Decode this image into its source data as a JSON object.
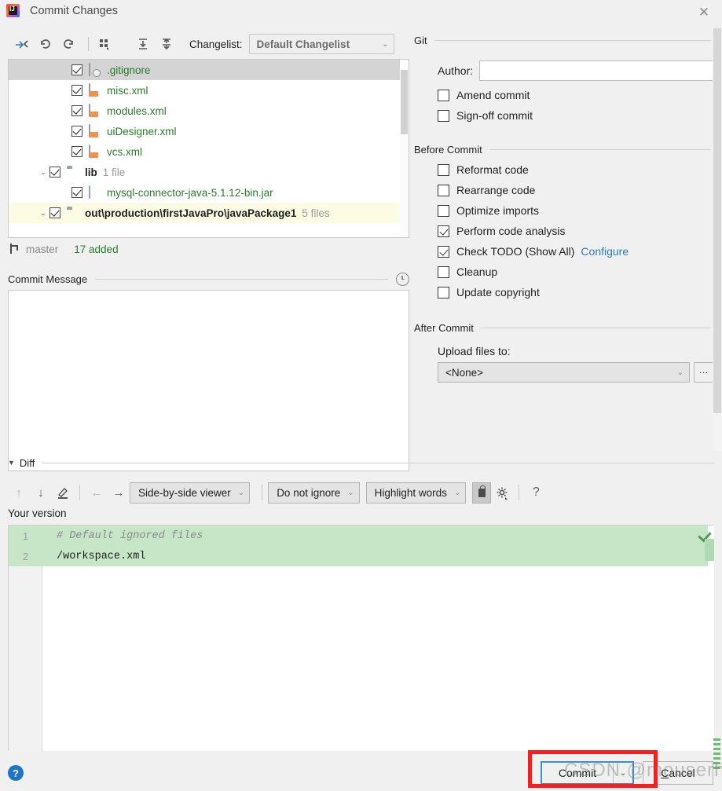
{
  "window": {
    "title": "Commit Changes",
    "app_icon": "intellij-idea-logo",
    "close_label": "✕"
  },
  "changelist_toolbar": {
    "icons": [
      {
        "name": "show-diff-icon",
        "glyph": "→←"
      },
      {
        "name": "rollback-icon",
        "glyph": "↶"
      },
      {
        "name": "refresh-icon",
        "glyph": "↻"
      },
      {
        "name": "group-by-icon",
        "glyph": "▦"
      },
      {
        "name": "expand-all-icon",
        "glyph": "⤓"
      },
      {
        "name": "collapse-all-icon",
        "glyph": "⤒"
      }
    ],
    "changelist_label": "Changelist:",
    "changelist_value": "Default Changelist",
    "chevron": "⌄"
  },
  "file_tree": {
    "rows": [
      {
        "name": ".gitignore",
        "icon": "gitignore-file-icon",
        "checked": true,
        "indent": 1,
        "state": "selected",
        "meta": "",
        "color": "green",
        "expander": ""
      },
      {
        "name": "misc.xml",
        "icon": "xml-file-icon",
        "checked": true,
        "indent": 1,
        "state": "",
        "meta": "",
        "color": "green",
        "expander": ""
      },
      {
        "name": "modules.xml",
        "icon": "xml-file-icon",
        "checked": true,
        "indent": 1,
        "state": "",
        "meta": "",
        "color": "green",
        "expander": ""
      },
      {
        "name": "uiDesigner.xml",
        "icon": "xml-file-icon",
        "checked": true,
        "indent": 1,
        "state": "",
        "meta": "",
        "color": "green",
        "expander": ""
      },
      {
        "name": "vcs.xml",
        "icon": "xml-file-icon",
        "checked": true,
        "indent": 1,
        "state": "",
        "meta": "",
        "color": "green",
        "expander": ""
      },
      {
        "name": "lib",
        "icon": "folder-icon",
        "checked": true,
        "indent": 0,
        "state": "",
        "meta": "1 file",
        "color": "dark",
        "expander": "⌄"
      },
      {
        "name": "mysql-connector-java-5.1.12-bin.jar",
        "icon": "jar-file-icon",
        "checked": true,
        "indent": 1,
        "state": "",
        "meta": "",
        "color": "green",
        "expander": ""
      },
      {
        "name": "out\\production\\firstJavaPro\\javaPackage1",
        "icon": "folder-icon",
        "checked": true,
        "indent": 0,
        "state": "highlighted",
        "meta": "5 files",
        "color": "dark",
        "expander": "⌄"
      }
    ]
  },
  "branch_status": {
    "icon": "git-branch-icon",
    "branch": "master",
    "changes": "17 added"
  },
  "commit_message": {
    "section_label": "Commit Message",
    "history_icon": "clock-icon",
    "value": "",
    "placeholder": ""
  },
  "git_section": {
    "title": "Git",
    "author_label": "Author:",
    "author_value": "",
    "author_placeholder": "",
    "checkboxes": [
      {
        "label": "Amend commit",
        "checked": false,
        "name": "amend-commit"
      },
      {
        "label": "Sign-off commit",
        "checked": false,
        "name": "sign-off-commit"
      }
    ]
  },
  "before_commit": {
    "title": "Before Commit",
    "checkboxes": [
      {
        "label": "Reformat code",
        "checked": false,
        "name": "reformat-code"
      },
      {
        "label": "Rearrange code",
        "checked": false,
        "name": "rearrange-code"
      },
      {
        "label": "Optimize imports",
        "checked": false,
        "name": "optimize-imports"
      },
      {
        "label": "Perform code analysis",
        "checked": true,
        "name": "perform-code-analysis"
      },
      {
        "label": "Check TODO (Show All)",
        "checked": true,
        "name": "check-todo",
        "link": "Configure"
      },
      {
        "label": "Cleanup",
        "checked": false,
        "name": "cleanup"
      },
      {
        "label": "Update copyright",
        "checked": false,
        "name": "update-copyright"
      }
    ]
  },
  "after_commit": {
    "title": "After Commit",
    "upload_label": "Upload files to:",
    "upload_value": "<None>",
    "chevron": "⌄",
    "browse_label": "…"
  },
  "diff_section": {
    "title": "Diff",
    "triangle": "▼",
    "toolbar": {
      "prev_diff_icon": "↑",
      "next_diff_icon": "↓",
      "edit_icon": "✎",
      "accept_left_icon": "←",
      "accept_right_icon": "→",
      "viewer_mode": "Side-by-side viewer",
      "ignore_mode": "Do not ignore",
      "highlight_mode": "Highlight words",
      "lock_icon": "lock-icon",
      "settings_icon": "⚙",
      "help_icon": "?",
      "chevron": "⌄"
    },
    "pane_label": "Your version",
    "lines": [
      {
        "num": "1",
        "text": "# Default ignored files",
        "style": "comment"
      },
      {
        "num": "2",
        "text": "/workspace.xml",
        "style": "code"
      }
    ]
  },
  "buttons": {
    "help": "?",
    "commit": "Commit",
    "commit_arrow": "⌄",
    "cancel": "Cancel"
  },
  "overlay": {
    "watermark": "CSDN @mouserh"
  },
  "colors": {
    "accent_blue": "#3a8fdc",
    "link_blue": "#2b7bc0",
    "added_green": "#2a7b2a",
    "diff_green_bg": "#c6e6c7",
    "highlight_red": "#fb1d1d",
    "selection_gray": "#d4d4d4"
  }
}
